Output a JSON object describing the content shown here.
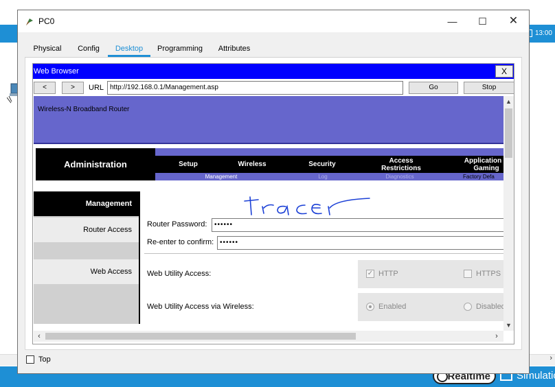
{
  "background": {
    "clock": "13:00",
    "realtime_label": "Realtime",
    "simulation_label": "Simulatio"
  },
  "window": {
    "title": "PC0",
    "controls": {
      "minimize": "—",
      "maximize": "☐",
      "close": "✕"
    },
    "tabs": [
      "Physical",
      "Config",
      "Desktop",
      "Programming",
      "Attributes"
    ],
    "active_tab": "Desktop",
    "top_checkbox_label": "Top"
  },
  "browser": {
    "title": "Web Browser",
    "close_label": "X",
    "back_label": "<",
    "forward_label": ">",
    "url_label": "URL",
    "url": "http://192.168.0.1/Management.asp",
    "go_label": "Go",
    "stop_label": "Stop"
  },
  "router_page": {
    "header_title": "Wireless-N Broadband Router",
    "section_title": "Administration",
    "menu": [
      "Setup",
      "Wireless",
      "Security",
      "Access Restrictions",
      "Application & Gaming"
    ],
    "submenu": [
      "Management",
      "Log",
      "Diagnostics",
      "Factory Defa"
    ],
    "sidebar": [
      "Management",
      "Router Access",
      "Web Access"
    ],
    "handwriting": "tracer",
    "router_password_label": "Router Password:",
    "router_password_value": "••••••",
    "reenter_label": "Re-enter to confirm:",
    "reenter_value": "••••••",
    "web_utility_access_label": "Web Utility Access:",
    "http_label": "HTTP",
    "https_label": "HTTPS",
    "http_checked": true,
    "https_checked": false,
    "wireless_access_label": "Web Utility Access via Wireless:",
    "enabled_label": "Enabled",
    "disabled_label": "Disabled",
    "wireless_access_value": "Enabled"
  },
  "colors": {
    "accent_blue": "#1e8fd5",
    "browser_titlebar": "#0000ff",
    "router_purple": "#6666cc",
    "handwriting_blue": "#1a3fd6"
  }
}
